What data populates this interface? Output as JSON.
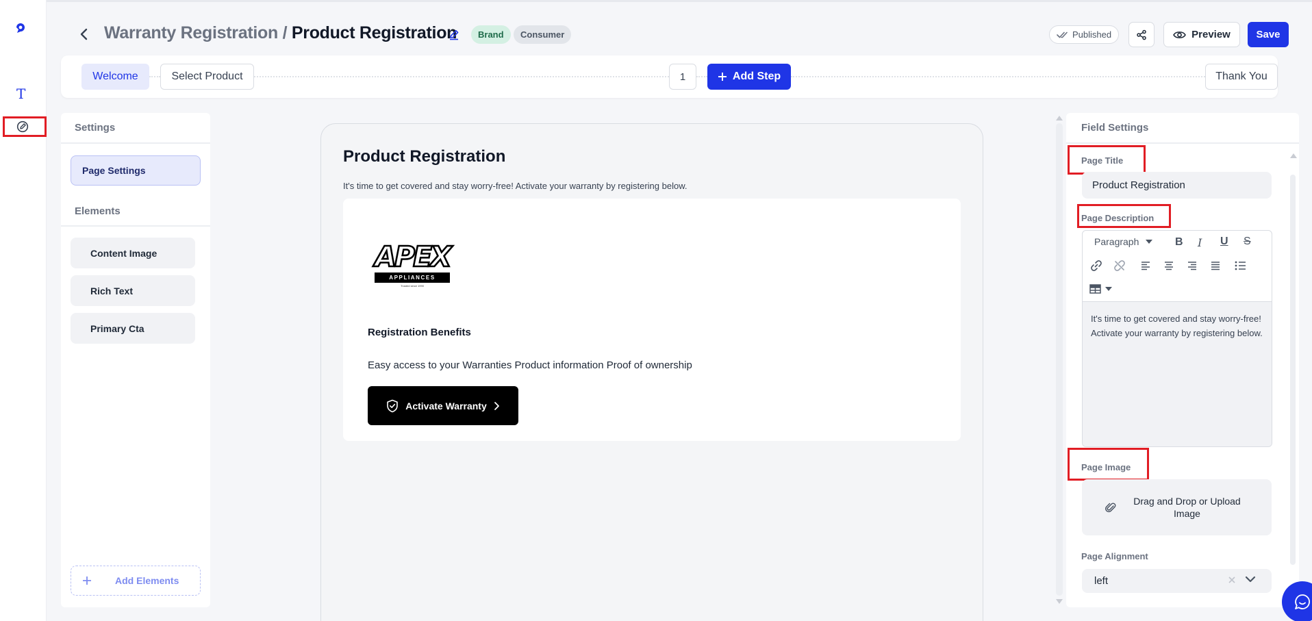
{
  "header": {
    "breadcrumb_parent": "Warranty Registration /",
    "breadcrumb_current": "Product Registration",
    "tags": [
      "Brand",
      "Consumer"
    ],
    "status": "Published",
    "preview_label": "Preview",
    "save_label": "Save"
  },
  "steps": {
    "welcome": "Welcome",
    "select_product": "Select Product",
    "count": "1",
    "add_step": "Add Step",
    "thank_you": "Thank You"
  },
  "left_panel": {
    "settings_title": "Settings",
    "page_settings": "Page Settings",
    "elements_title": "Elements",
    "elements": [
      "Content Image",
      "Rich Text",
      "Primary Cta"
    ],
    "add_elements": "Add Elements"
  },
  "canvas": {
    "title": "Product Registration",
    "description": "It's time to get covered and stay worry-free! Activate your warranty by registering below.",
    "logo": {
      "word": "APEX",
      "sub": "APPLIANCES",
      "tagline": "Trusted since 1990"
    },
    "benefits_heading": "Registration Benefits",
    "benefits_text": "Easy access to your Warranties Product information Proof of ownership",
    "cta_label": "Activate Warranty"
  },
  "field_settings": {
    "title": "Field Settings",
    "page_title_label": "Page Title",
    "page_title_value": "Product Registration",
    "page_description_label": "Page Description",
    "paragraph_select": "Paragraph",
    "description_value": "It's time to get covered and stay worry-free! Activate your warranty by registering below.",
    "page_image_label": "Page Image",
    "upload_text": "Drag and Drop or Upload Image",
    "alignment_label": "Page Alignment",
    "alignment_value": "left"
  },
  "colors": {
    "accent": "#1f35e6",
    "highlight": "#e11d24",
    "brand_tag_bg": "#d4f0e3"
  }
}
